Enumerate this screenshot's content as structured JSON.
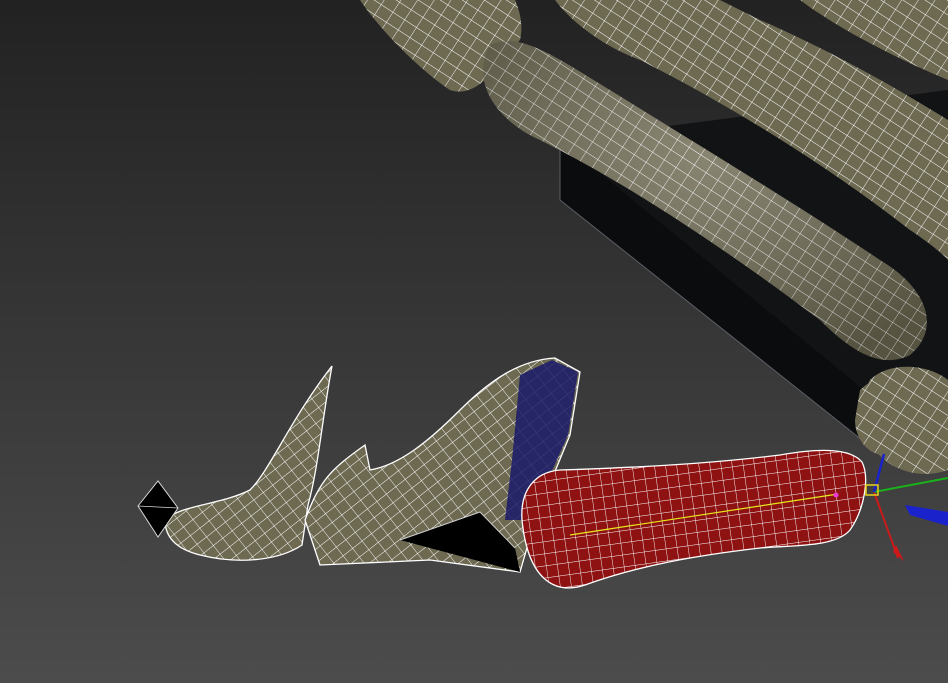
{
  "viewport": {
    "view": "perspective",
    "shading": "edged-faces",
    "background": {
      "top": "#222222",
      "bottom": "#4c4c4c"
    }
  },
  "materials": {
    "bone": "#6e6a52",
    "bone_highlight": "#8a8466",
    "wire": "#ffffff",
    "selected_fill": "#8e1212",
    "box": "#121315",
    "blue_face": "#1a1a6a"
  },
  "objects": [
    {
      "name": "metacarpal-bones",
      "type": "mesh"
    },
    {
      "name": "base-box",
      "type": "box"
    },
    {
      "name": "distal-phalanx-claw",
      "type": "mesh"
    },
    {
      "name": "middle-phalanx-claw",
      "type": "mesh"
    },
    {
      "name": "proximal-phalanx",
      "type": "mesh",
      "selected": true
    },
    {
      "name": "knuckle-joint",
      "type": "mesh"
    },
    {
      "name": "tip-helper",
      "type": "helper"
    },
    {
      "name": "bone-link",
      "type": "helper"
    }
  ],
  "gizmo": {
    "type": "move-transform",
    "x_color": "#cc1a1a",
    "y_color": "#19b21a",
    "z_color": "#1a22cc",
    "plane_color": "#e8d21c"
  }
}
